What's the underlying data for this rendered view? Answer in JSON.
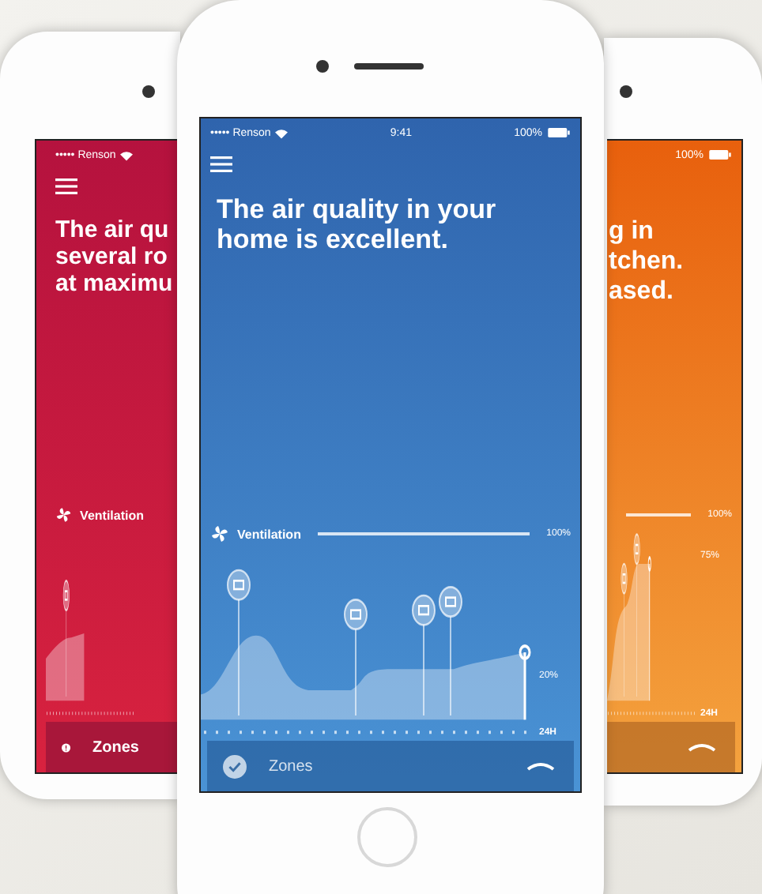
{
  "phones": [
    {
      "kind": "red",
      "status_bar": {
        "carrier": "••••• Renson"
      },
      "message": [
        "The air qu",
        "several ro",
        "at maximu"
      ],
      "ventilation": "Ventilation",
      "zones": {
        "label": "Zones",
        "kind": "alert"
      }
    },
    {
      "kind": "blue",
      "status_bar": {
        "carrier": "••••• Renson",
        "time": "9:41",
        "battery": "100%"
      },
      "message": [
        "The air quality in your home is excellent."
      ],
      "ventilation": "Ventilation",
      "top_label": "100%",
      "current_label": "20%",
      "axis_end": "24H",
      "zones": {
        "label": "Zones",
        "kind": "check"
      }
    },
    {
      "kind": "orange",
      "status_bar": {
        "battery": "100%"
      },
      "message": [
        "g in",
        "tchen.",
        "ased."
      ],
      "top_label": "100%",
      "current_label": "75%",
      "axis_end": "24H"
    }
  ]
}
